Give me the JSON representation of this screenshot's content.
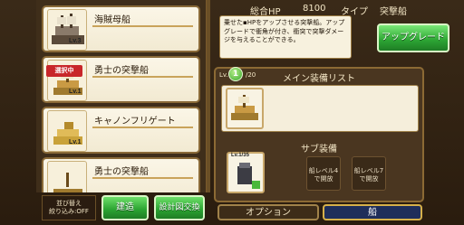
{
  "ship_list": {
    "items": [
      {
        "name": "海賊母船",
        "level": "Lv.3",
        "selected": false
      },
      {
        "name": "勇士の突撃船",
        "level": "Lv.1",
        "selected": true
      },
      {
        "name": "キャノンフリゲート",
        "level": "Lv.1",
        "selected": false
      },
      {
        "name": "勇士の突撃船",
        "level": "",
        "selected": false
      }
    ],
    "selected_label": "選択中"
  },
  "buttons": {
    "sort_line1": "並び替え",
    "sort_line2": "絞り込み:OFF",
    "build": "建造",
    "blueprint_exchange": "設計図交換",
    "upgrade": "アップグレード",
    "options": "オプション",
    "ship": "船"
  },
  "stats": {
    "total_hp_label": "総合HP",
    "total_hp_value": "8100",
    "type_label": "タイプ",
    "type_value": "突撃船"
  },
  "description": "乗せた▪HPをアップさせる突撃船。アップグレードで衝角が付き、衝突で突撃ダメージを与えることができる。",
  "main_equipment": {
    "header": "メイン装備リスト",
    "level_prefix": "Lv.",
    "level": "1",
    "level_max": "/20"
  },
  "sub_equipment": {
    "header": "サブ装備",
    "slot_level": "Lv.1/35",
    "locked_slots": [
      "船レベル4で開放",
      "船レベル7で開放"
    ]
  },
  "colors": {
    "accent_green": "#2aa231",
    "selected_red": "#c8262a",
    "panel_brown": "#4a3620"
  }
}
